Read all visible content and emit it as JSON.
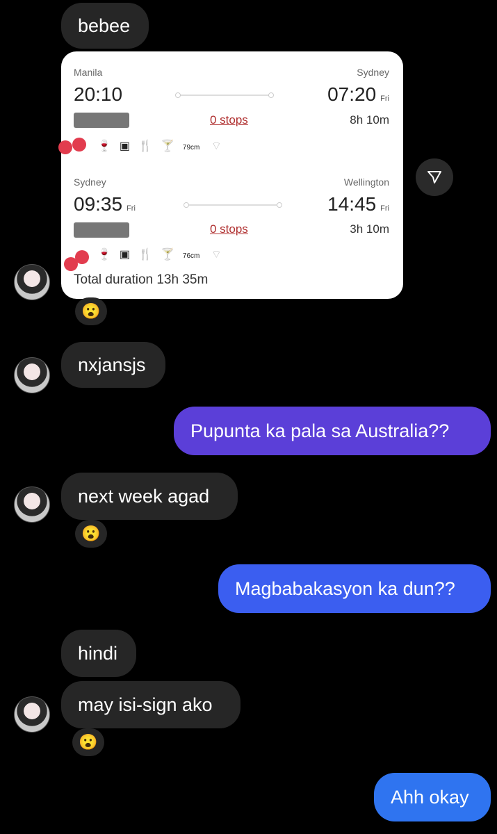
{
  "messages": {
    "m1": "bebee",
    "m2": "nxjansjs",
    "m3": "Pupunta ka pala sa Australia??",
    "m4": "next week agad",
    "m5": "Magbabakasyon ka dun??",
    "m6": "hindi",
    "m7": "may isi-sign ako",
    "m8": "Ahh okay"
  },
  "reactions": {
    "emoji": "😮"
  },
  "flight": {
    "leg1": {
      "from_city": "Manila",
      "to_city": "Sydney",
      "depart_time": "20:10",
      "arrive_time": "07:20",
      "arrive_day": "Fri",
      "stops": "0 stops",
      "duration": "8h 10m",
      "seat_pitch": "79cm"
    },
    "leg2": {
      "from_city": "Sydney",
      "to_city": "Wellington",
      "depart_time": "09:35",
      "depart_day": "Fri",
      "arrive_time": "14:45",
      "arrive_day": "Fri",
      "stops": "0 stops",
      "duration": "3h 10m",
      "seat_pitch": "76cm"
    },
    "total": "Total duration 13h 35m"
  },
  "icons": {
    "share": "paper-plane-icon",
    "amenities": [
      "wine-glass-icon",
      "screen-icon",
      "meal-icon",
      "drinks-icon",
      "seat-pitch-icon",
      "wifi-icon"
    ]
  },
  "colors": {
    "background": "#000000",
    "incoming_bubble": "#262626",
    "outgoing_purple": "#5b3fd8",
    "outgoing_blue": "#3b5ef0",
    "stops_link": "#b03030"
  }
}
